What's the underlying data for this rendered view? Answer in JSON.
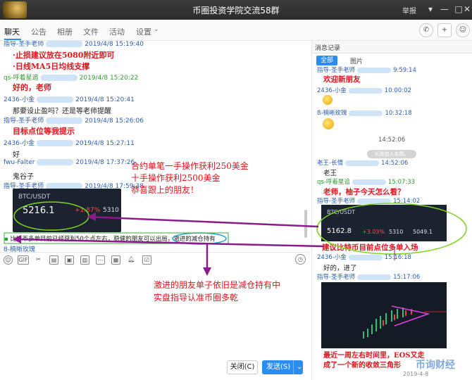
{
  "titlebar": {
    "title": "币圈投资学院交流58群",
    "report": "举报"
  },
  "tabs": [
    "聊天",
    "公告",
    "相册",
    "文件",
    "活动",
    "设置"
  ],
  "chat": {
    "messages": [
      {
        "name": "指导-圣手老师",
        "time": "2019/4/8 15:19:40",
        "type": "red",
        "text": "·止损建议放在5080附近即可"
      },
      {
        "type": "red",
        "text": "·日线MA5日均线支撑"
      },
      {
        "name": "qs-呼着星追",
        "time": "2019/4/8 15:20:22",
        "type": "red",
        "text": "好的，老师"
      },
      {
        "name": "2436-小金",
        "time": "2019/4/8 15:20:41",
        "type": "text",
        "text": "那要设止盈吗？还是等老师提醒"
      },
      {
        "name": "指导-圣手老师",
        "time": "2019/4/8 15:26:06",
        "type": "red",
        "text": "目标点位等我提示"
      },
      {
        "name": "2436-小金",
        "time": "2019/4/8 15:27:11",
        "type": "text",
        "text": "好"
      },
      {
        "name": "fwu-Falter",
        "time": "2019/4/8 17:37:26",
        "type": "text",
        "text": "鬼谷子"
      },
      {
        "name": "指导-圣手老师",
        "time": "2019/4/8 17:59:38",
        "type": "card"
      }
    ],
    "btc_card": {
      "pair": "BTC/USDT",
      "price": "5216.1",
      "change": "+1.87%",
      "volume": "5310"
    },
    "annotation": [
      "合约单笔一手操作获利250美金",
      "十手操作获利2500美金",
      "恭喜跟上的朋友！"
    ],
    "input_text": "比特币多单目前已经获利50个点左右，稳健的朋友可以出局，激进的减仓持有",
    "next_sender": "8-楠晰玫瑰"
  },
  "bottom_annotation": [
    "激进的朋友单子依旧是减仓持有中",
    "实盘指导认准币圈多乾"
  ],
  "buttons": {
    "close": "关闭(C)",
    "send": "发送(S)"
  },
  "panel": {
    "header": "消息记录",
    "tab_all": "全部",
    "tab_pic": "图片",
    "items": [
      {
        "name": "指导-圣手老师",
        "time": "9:59:14",
        "type": "red",
        "text": "欢迎新朋友"
      },
      {
        "name": "2436-小金",
        "time": "10:00:02",
        "type": "emoji"
      },
      {
        "name": "8-楠晰玫瑰",
        "time": "10:32:18",
        "type": "emoji"
      },
      {
        "stamp": "14:52:06",
        "sys": "长按加入本群。"
      },
      {
        "name": "老王-长情",
        "time": "14:52:06",
        "type": "text",
        "text": "老王"
      },
      {
        "name": "qs-呼着星追",
        "time": "15:07:33",
        "type": "red",
        "text": "老师，柚子今天怎么看？"
      },
      {
        "name": "指导-圣手老师",
        "time": "15:14:02",
        "type": "card"
      },
      {
        "type": "red",
        "text": "建议比特币目前点位多单入场"
      },
      {
        "name": "2436-小金",
        "time": "15:16:18",
        "type": "text",
        "text": "好的，进了"
      },
      {
        "name": "指导-圣手老师",
        "time": "15:17:06",
        "type": "chart"
      },
      {
        "type": "red",
        "text": "最近一周左右时间里，EOS又走"
      },
      {
        "type": "red",
        "text": "成了一个新的收敛三角形"
      }
    ],
    "mini_card": {
      "pair": "BTC/USDT",
      "price": "5162.8",
      "change": "+3.03%",
      "volume": "5310",
      "high": "5049.1"
    }
  },
  "watermark": {
    "brand": "币询财经",
    "date": "2019-4-8"
  },
  "colors": {
    "accent": "#2d8cf0",
    "red_text": "#e0141c",
    "arrow": "#8b1a8b",
    "highlight": "#7ed321"
  }
}
